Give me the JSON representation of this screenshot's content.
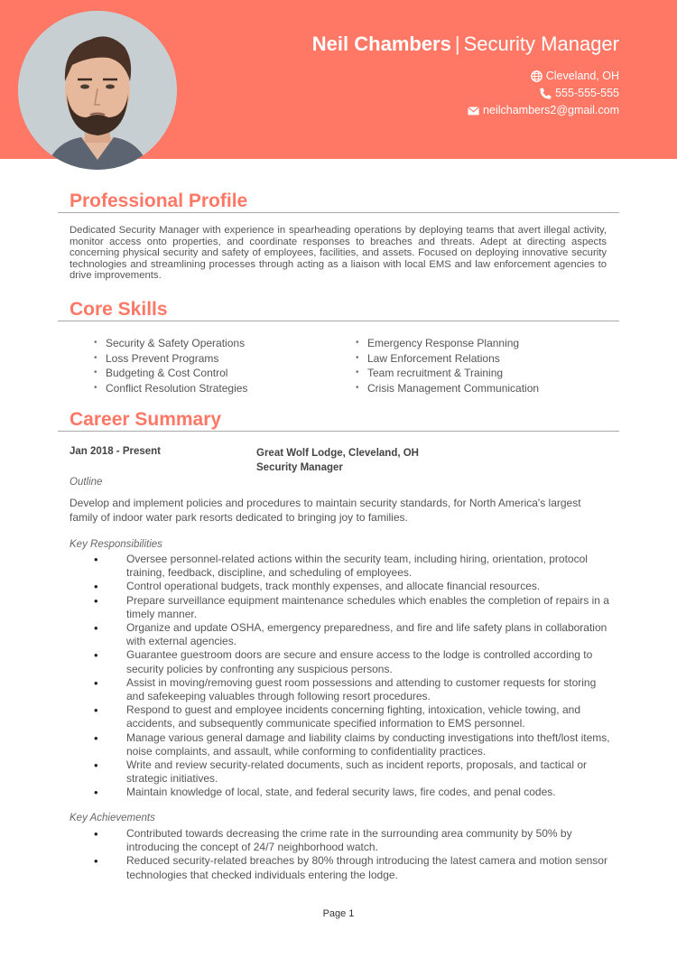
{
  "header": {
    "name": "Neil Chambers",
    "separator": "|",
    "job_title": "Security Manager",
    "accent_color": "#ff7866",
    "photo_alt": "Profile photo of Neil Chambers",
    "contact": {
      "location": "Cleveland, OH",
      "location_icon": "globe-icon",
      "phone": "555-555-555",
      "phone_icon": "phone-icon",
      "email": "neilchambers2@gmail.com",
      "email_icon": "envelope-icon"
    }
  },
  "profile": {
    "heading": "Professional Profile",
    "text": "Dedicated Security Manager with experience in spearheading operations by deploying teams that avert illegal activity, monitor access onto properties, and coordinate responses to breaches and threats. Adept at directing aspects concerning physical security and safety of employees, facilities, and assets. Focused on deploying innovative security technologies and streamlining processes through acting as a liaison with local EMS and law enforcement agencies to drive improvements."
  },
  "skills": {
    "heading": "Core Skills",
    "bullet": "•",
    "left": [
      "Security & Safety Operations",
      "Loss Prevent Programs",
      "Budgeting & Cost Control",
      "Conflict Resolution Strategies"
    ],
    "right": [
      "Emergency Response Planning",
      "Law Enforcement Relations",
      "Team recruitment & Training",
      "Crisis Management Communication"
    ]
  },
  "career": {
    "heading": "Career Summary",
    "jobs": [
      {
        "dates": "Jan 2018 - Present",
        "company": "Great Wolf Lodge, Cleveland, OH",
        "role": "Security Manager",
        "outline_label": "Outline",
        "outline": "Develop and implement policies and procedures to maintain security standards, for North America's largest family of indoor water park resorts dedicated to bringing joy to families.",
        "responsibilities_label": "Key Responsibilities",
        "responsibilities": [
          "Oversee personnel-related actions within the security team, including hiring, orientation, protocol training, feedback, discipline, and scheduling of employees.",
          "Control operational budgets, track monthly expenses, and allocate financial resources.",
          "Prepare surveillance equipment maintenance schedules which enables the completion of repairs in a timely manner.",
          "Organize and update OSHA, emergency preparedness, and fire and life safety plans in collaboration with external agencies.",
          "Guarantee guestroom doors are secure and ensure access to the lodge is controlled according to security policies by confronting any suspicious persons.",
          "Assist in moving/removing guest room possessions and attending to customer requests for storing and safekeeping valuables through following resort procedures.",
          "Respond to guest and employee incidents concerning fighting, intoxication, vehicle towing, and accidents, and subsequently communicate specified information to EMS personnel.",
          "Manage various general damage and liability claims by conducting investigations into theft/lost items, noise complaints, and assault, while conforming to confidentiality practices.",
          "Write and review security-related documents, such as incident reports, proposals, and tactical or strategic initiatives.",
          "Maintain knowledge of local, state, and federal security laws, fire codes, and penal codes."
        ],
        "achievements_label": "Key Achievements",
        "achievements": [
          "Contributed towards decreasing the crime rate in the surrounding area community by 50% by introducing the concept of 24/7 neighborhood watch.",
          "Reduced security-related breaches by 80% through introducing the latest camera and motion sensor technologies that checked individuals entering the lodge."
        ]
      }
    ]
  },
  "footer": {
    "page_label": "Page 1"
  }
}
